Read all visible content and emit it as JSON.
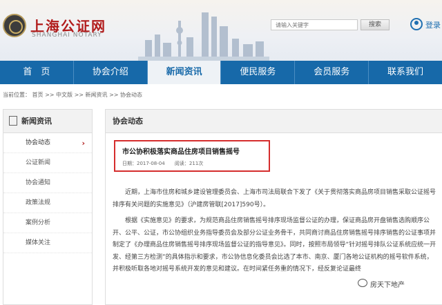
{
  "header": {
    "logo_cn": "上海公证网",
    "logo_en": "SHANGHAI NOTARY",
    "search_placeholder": "请输入关键字",
    "search_button": "搜索",
    "login_label": "登录"
  },
  "nav": {
    "items": [
      {
        "label": "首　页"
      },
      {
        "label": "协会介绍"
      },
      {
        "label": "新闻资讯"
      },
      {
        "label": "便民服务"
      },
      {
        "label": "会员服务"
      },
      {
        "label": "联系我们"
      }
    ],
    "active_index": 2
  },
  "breadcrumb": "当前位置： 首页 >> 中文版 >> 新闻资讯 >> 协会动态",
  "sidebar": {
    "title": "新闻资讯",
    "items": [
      {
        "label": "协会动态"
      },
      {
        "label": "公证新闻"
      },
      {
        "label": "协会通知"
      },
      {
        "label": "政策法规"
      },
      {
        "label": "案例分析"
      },
      {
        "label": "媒体关注"
      }
    ]
  },
  "main": {
    "section_title": "协会动态",
    "article_title": "市公协积极落实商品住房项目销售摇号",
    "date": "日期：2017-08-04",
    "reads": "阅读：211次",
    "paragraphs": [
      "近期，上海市住房和城乡建设管理委员会、上海市司法局联合下发了《关于贯彻落实商品房项目销售采取公证摇号排序有关问题的实施意见》（沪建房管联[2017]590号）。",
      "根据《实施意见》的要求，为规范商品住房销售摇号排序现场监督公证的办理，保证商品房开盘销售选购顺序公开、公平、公证，市公协组织业务指导委员会及部分公证业务骨干，共同商讨商品住房销售摇号排序销售的公证事项并制定了《办理商品住房销售摇号排序现场监督公证的指导意见》。同时，按照市局领导“针对摇号排队公证系统应统一开发、经第三方检测”的具体指示和要求，市公协信息化委员会比选了本市、南京、厦门各地公证机构的摇号软件系统，并积极听取各地对摇号系统开发的意见和建议。在时间紧任务重的情况下，经反复论证最终"
    ]
  },
  "watermark": "房天下地产"
}
